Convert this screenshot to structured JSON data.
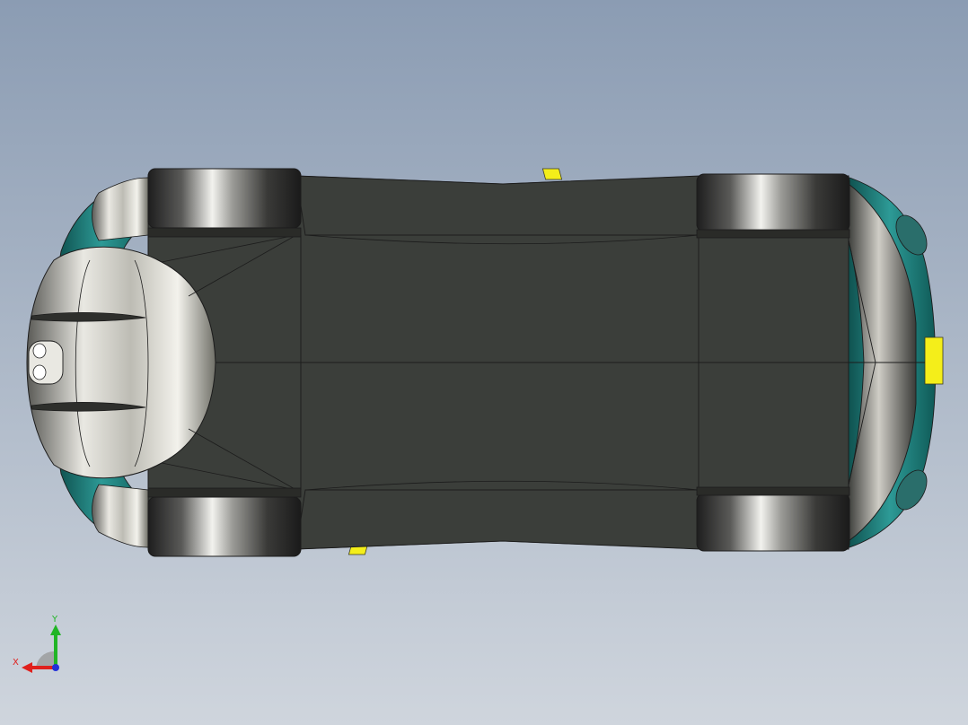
{
  "viewport": {
    "background_top": "#8b9cb3",
    "background_bottom": "#cfd5dd"
  },
  "model": {
    "body_dark": "#3b3e3a",
    "body_edge": "#1c1c1c",
    "teal": "#1f7a77",
    "accent_yellow": "#f4ee1a",
    "chrome": "#d8d6cf"
  },
  "triad": {
    "x_label": "X",
    "y_label": "Y",
    "x_color": "#e0201d",
    "y_color": "#21b526",
    "z_color": "#2330d8"
  }
}
